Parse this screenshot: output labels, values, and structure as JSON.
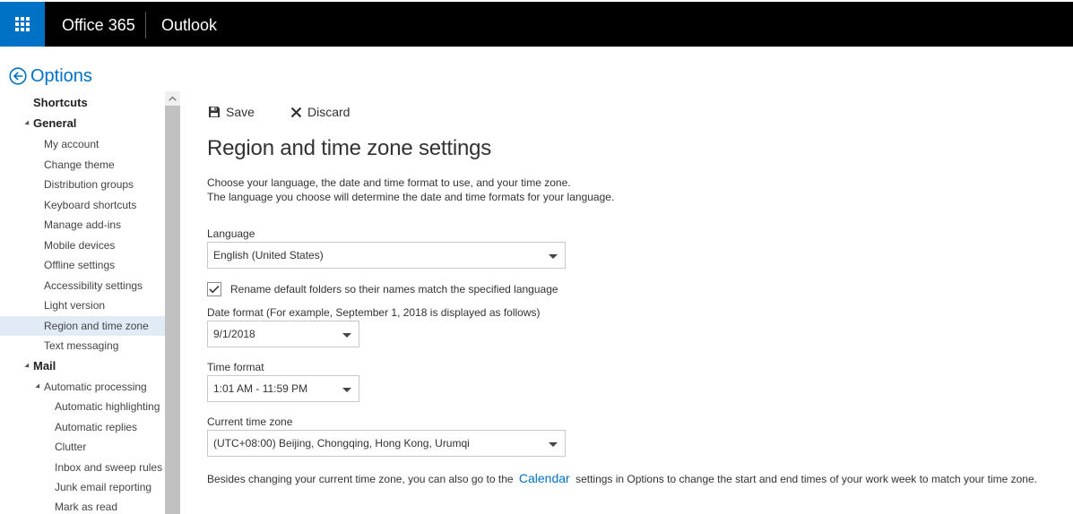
{
  "header": {
    "brand": "Office 365",
    "app_name": "Outlook"
  },
  "options": {
    "title": "Options"
  },
  "nav": {
    "items": [
      {
        "label": "Shortcuts"
      },
      {
        "label": "General"
      },
      {
        "label": "My account"
      },
      {
        "label": "Change theme"
      },
      {
        "label": "Distribution groups"
      },
      {
        "label": "Keyboard shortcuts"
      },
      {
        "label": "Manage add-ins"
      },
      {
        "label": "Mobile devices"
      },
      {
        "label": "Offline settings"
      },
      {
        "label": "Accessibility settings"
      },
      {
        "label": "Light version"
      },
      {
        "label": "Region and time zone"
      },
      {
        "label": "Text messaging"
      },
      {
        "label": "Mail"
      },
      {
        "label": "Automatic processing"
      },
      {
        "label": "Automatic highlighting"
      },
      {
        "label": "Automatic replies"
      },
      {
        "label": "Clutter"
      },
      {
        "label": "Inbox and sweep rules"
      },
      {
        "label": "Junk email reporting"
      },
      {
        "label": "Mark as read"
      }
    ]
  },
  "toolbar": {
    "save_label": "Save",
    "discard_label": "Discard"
  },
  "page": {
    "title": "Region and time zone settings",
    "desc_line1": "Choose your language, the date and time format to use, and your time zone.",
    "desc_line2": "The language you choose will determine the date and time formats for your language."
  },
  "language": {
    "label": "Language",
    "value": "English (United States)"
  },
  "rename_folders": {
    "label": "Rename default folders so their names match the specified language",
    "checked": true
  },
  "date_format": {
    "label": "Date format (For example, September 1, 2018 is displayed as follows)",
    "value": "9/1/2018"
  },
  "time_format": {
    "label": "Time format",
    "value": "1:01 AM - 11:59 PM"
  },
  "time_zone": {
    "label": "Current time zone",
    "value": "(UTC+08:00) Beijing, Chongqing, Hong Kong, Urumqi"
  },
  "footer": {
    "text_before": "Besides changing your current time zone, you can also go to the",
    "link": "Calendar",
    "text_after": "settings in Options to change the start and end times of your work week to match your time zone."
  },
  "colors": {
    "accent": "#0072c6",
    "topbar": "#000000",
    "selected_nav": "#e1ebf5"
  },
  "icons": [
    "app-launcher-icon",
    "back-arrow-icon",
    "save-icon",
    "discard-icon",
    "checkmark-icon",
    "scroll-up-icon",
    "chevron-down-icon"
  ]
}
